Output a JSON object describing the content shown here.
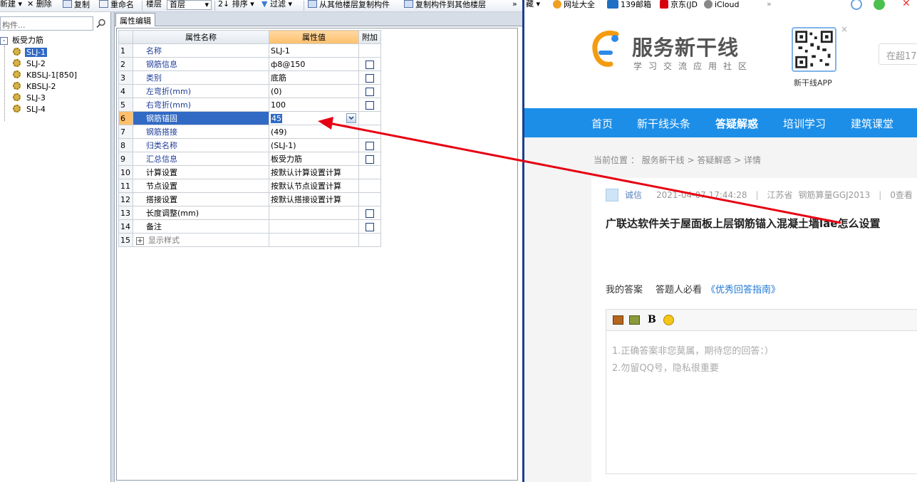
{
  "toolbar": {
    "new_label": "新建",
    "delete_label": "删除",
    "copy_label": "复制",
    "rename_label": "重命名",
    "floor_label": "楼层",
    "floor_value": "首层",
    "sort_label": "排序",
    "filter_label": "过滤",
    "copy_from_floor_label": "从其他楼层复制构件",
    "copy_to_floor_label": "复制构件到其他楼层",
    "more_label": "»"
  },
  "sidebar": {
    "search_placeholder": "构件...",
    "root_label": "板受力筋",
    "items": [
      {
        "label": "SLJ-1",
        "selected": true
      },
      {
        "label": "SLJ-2",
        "selected": false
      },
      {
        "label": "KBSLJ-1[850]",
        "selected": false
      },
      {
        "label": "KBSLJ-2",
        "selected": false
      },
      {
        "label": "SLJ-3",
        "selected": false
      },
      {
        "label": "SLJ-4",
        "selected": false
      }
    ]
  },
  "panel": {
    "tab_label": "属性编辑",
    "headers": {
      "name": "属性名称",
      "value": "属性值",
      "extra": "附加"
    },
    "rows": [
      {
        "num": "1",
        "name": "名称",
        "value": "SLJ-1",
        "check": false
      },
      {
        "num": "2",
        "name": "钢筋信息",
        "value": "ф8@150",
        "check": true
      },
      {
        "num": "3",
        "name": "类别",
        "value": "底筋",
        "check": true
      },
      {
        "num": "4",
        "name": "左弯折(mm)",
        "value": "(0)",
        "check": true
      },
      {
        "num": "5",
        "name": "右弯折(mm)",
        "value": "100",
        "check": true
      },
      {
        "num": "6",
        "name": "钢筋锚固",
        "value": "45",
        "check": false
      },
      {
        "num": "7",
        "name": "钢筋搭接",
        "value": "(49)",
        "check": false
      },
      {
        "num": "8",
        "name": "归类名称",
        "value": "(SLJ-1)",
        "check": true
      },
      {
        "num": "9",
        "name": "汇总信息",
        "value": "板受力筋",
        "check": true
      },
      {
        "num": "10",
        "name": "计算设置",
        "value": "按默认计算设置计算",
        "check": false
      },
      {
        "num": "11",
        "name": "节点设置",
        "value": "按默认节点设置计算",
        "check": false
      },
      {
        "num": "12",
        "name": "搭接设置",
        "value": "按默认搭接设置计算",
        "check": false
      },
      {
        "num": "13",
        "name": "长度调整(mm)",
        "value": "",
        "check": true
      },
      {
        "num": "14",
        "name": "备注",
        "value": "",
        "check": true
      },
      {
        "num": "15",
        "name": "显示样式",
        "value": "",
        "check": false
      }
    ]
  },
  "bookmarks": {
    "first": "藏",
    "items": [
      "网址大全",
      "139邮箱",
      "京东(JD",
      "iCloud"
    ],
    "more": "»"
  },
  "site": {
    "title": "服务新干线",
    "subtitle": "学习交流应用社区",
    "qr_label": "新干线APP",
    "qr_close": "×",
    "search_placeholder": "在超17",
    "nav": [
      "首页",
      "新干线头条",
      "答疑解惑",
      "培训学习",
      "建筑课堂"
    ],
    "breadcrumb": "当前位置 ： 服务新干线 > 答疑解惑 > 详情",
    "meta": {
      "author": "诚信",
      "date": "2021-04-07 17:44:28",
      "location": "江苏省",
      "product": "钢筋算量GGJ2013",
      "views": "0查看"
    },
    "question_title": "广联达软件关于屋面板上层钢筋锚入混凝土墙lae怎么设置",
    "answer_tabs": {
      "mine": "我的答案",
      "notice": "答题人必看",
      "guide": "《优秀回答指南》"
    },
    "editor": {
      "bold": "B",
      "placeholder_1": "1.正确答案非您莫属，期待您的回答：）",
      "placeholder_2": "2.勿留QQ号，隐私很重要"
    }
  },
  "colors": {
    "selection": "#316ac5",
    "nav_blue": "#1c8ee8",
    "arrow_red": "#e60012",
    "header_orange": "#ffbf6b"
  }
}
